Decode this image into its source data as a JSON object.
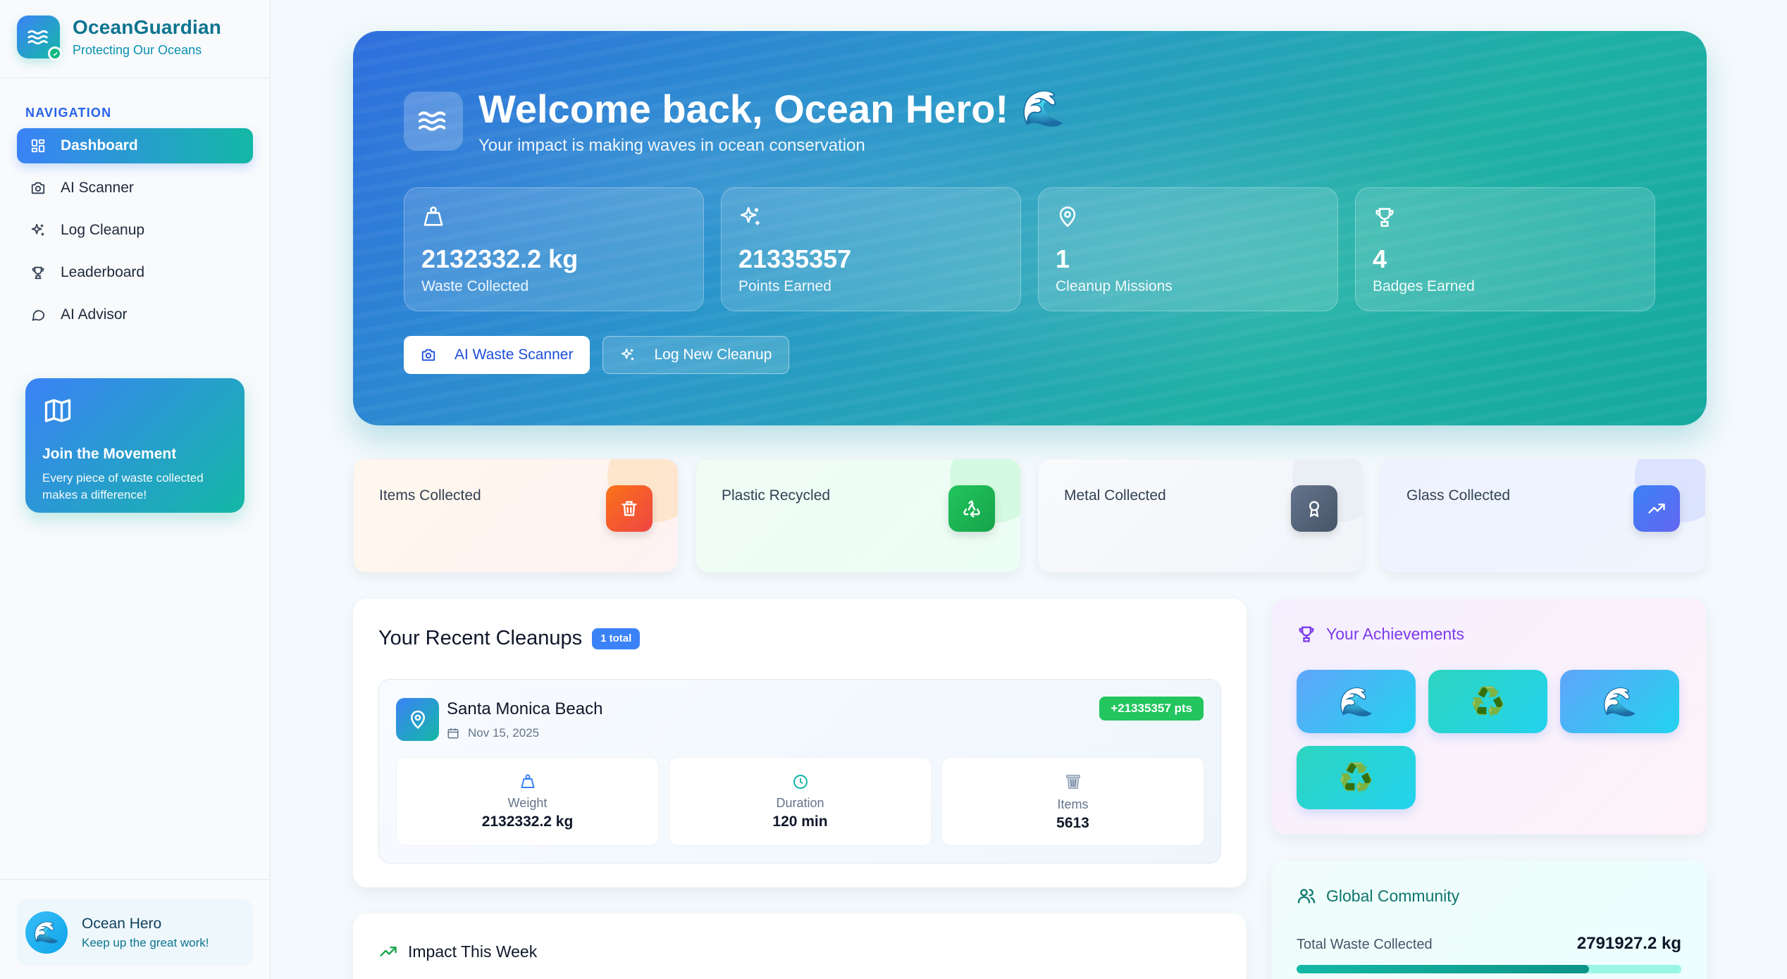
{
  "brand": {
    "name": "OceanGuardian",
    "tagline": "Protecting Our Oceans"
  },
  "sidebar": {
    "heading": "NAVIGATION",
    "items": [
      {
        "label": "Dashboard",
        "icon": "grid-icon",
        "active": true
      },
      {
        "label": "AI Scanner",
        "icon": "camera-icon"
      },
      {
        "label": "Log Cleanup",
        "icon": "sparkles-icon"
      },
      {
        "label": "Leaderboard",
        "icon": "trophy-icon"
      },
      {
        "label": "AI Advisor",
        "icon": "chat-bubble-icon"
      }
    ],
    "promo": {
      "title": "Join the Movement",
      "text": "Every piece of waste collected makes a difference!"
    },
    "user": {
      "name": "Ocean Hero",
      "subtitle": "Keep up the great work!"
    }
  },
  "hero": {
    "title": "Welcome back, Ocean Hero!",
    "emoji": "🌊",
    "subtitle": "Your impact is making waves in ocean conservation",
    "stats": [
      {
        "value": "2132332.2 kg",
        "label": "Waste Collected",
        "icon": "weight-icon"
      },
      {
        "value": "21335357",
        "label": "Points Earned",
        "icon": "sparkles-icon"
      },
      {
        "value": "1",
        "label": "Cleanup Missions",
        "icon": "map-pin-icon"
      },
      {
        "value": "4",
        "label": "Badges Earned",
        "icon": "trophy-icon"
      }
    ],
    "actions": {
      "scanner": "AI Waste Scanner",
      "log": "Log New Cleanup"
    }
  },
  "categories": [
    {
      "label": "Items Collected",
      "icon": "trash-icon",
      "color": "#f97316"
    },
    {
      "label": "Plastic Recycled",
      "icon": "recycle-icon",
      "color": "#22c55e"
    },
    {
      "label": "Metal Collected",
      "icon": "award-icon",
      "color": "#475569"
    },
    {
      "label": "Glass Collected",
      "icon": "trending-up-icon",
      "color": "#6366f1"
    }
  ],
  "recent": {
    "title": "Your Recent Cleanups",
    "count_badge": "1 total",
    "cleanup": {
      "location": "Santa Monica Beach",
      "date": "Nov 15, 2025",
      "points": "+21335357 pts",
      "metrics": [
        {
          "label": "Weight",
          "value": "2132332.2 kg",
          "icon": "weight-icon"
        },
        {
          "label": "Duration",
          "value": "120 min",
          "icon": "clock-icon"
        },
        {
          "label": "Items",
          "value": "5613",
          "icon": "wastebasket-icon"
        }
      ]
    }
  },
  "impact": {
    "title": "Impact This Week"
  },
  "achievements": {
    "title": "Your Achievements",
    "badges": [
      {
        "emoji": "🌊",
        "style": "blue"
      },
      {
        "emoji": "♻️",
        "style": "teal"
      },
      {
        "emoji": "🌊",
        "style": "blue"
      },
      {
        "emoji": "♻️",
        "style": "teal"
      }
    ]
  },
  "community": {
    "title": "Global Community",
    "label": "Total Waste Collected",
    "value": "2791927.2 kg",
    "progress_fraction": 0.76
  }
}
